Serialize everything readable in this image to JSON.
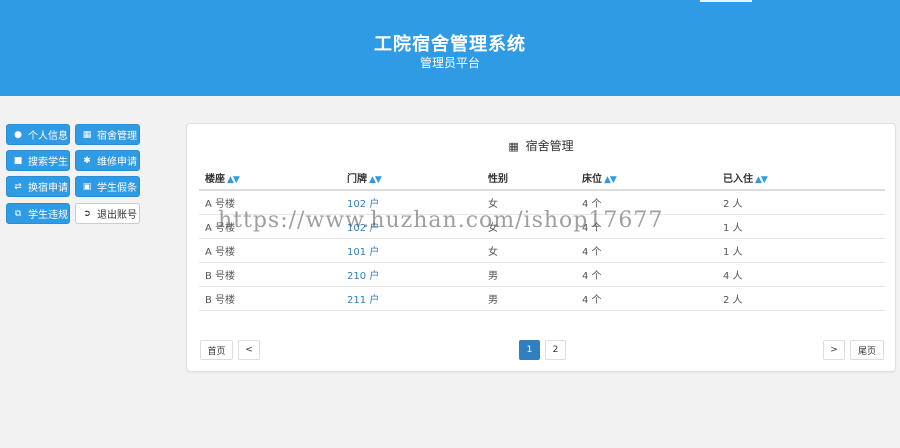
{
  "header": {
    "title": "工院宿舍管理系统",
    "subtitle": "管理员平台"
  },
  "sidebar": {
    "items": [
      {
        "label": "个人信息",
        "icon": "user-icon"
      },
      {
        "label": "宿舍管理",
        "icon": "building-icon"
      },
      {
        "label": "搜索学生",
        "icon": "student-icon"
      },
      {
        "label": "维修申请",
        "icon": "wrench-icon"
      },
      {
        "label": "换宿申请",
        "icon": "exchange-icon"
      },
      {
        "label": "学生假条",
        "icon": "lock-icon"
      },
      {
        "label": "学生违规",
        "icon": "copy-icon"
      },
      {
        "label": "退出账号",
        "icon": "logout-icon"
      }
    ]
  },
  "panel": {
    "title": "宿舍管理",
    "columns": [
      "楼座",
      "门牌",
      "性别",
      "床位",
      "已入住"
    ],
    "rows": [
      [
        "A 号楼",
        "102 户",
        "女",
        "4 个",
        "2 人"
      ],
      [
        "A 号楼",
        "102 户",
        "女",
        "4 个",
        "1 人"
      ],
      [
        "A 号楼",
        "101 户",
        "女",
        "4 个",
        "1 人"
      ],
      [
        "B 号楼",
        "210 户",
        "男",
        "4 个",
        "4 人"
      ],
      [
        "B 号楼",
        "211 户",
        "男",
        "4 个",
        "2 人"
      ]
    ]
  },
  "pager": {
    "first": "首页",
    "prev": "<",
    "pages": [
      "1",
      "2"
    ],
    "active_page": "1",
    "next": ">",
    "last": "尾页"
  },
  "watermark": "https://www.huzhan.com/ishop17677",
  "colors": {
    "brand": "#2f9be4",
    "link": "#2f7fc1",
    "background": "#f2f2f2"
  }
}
